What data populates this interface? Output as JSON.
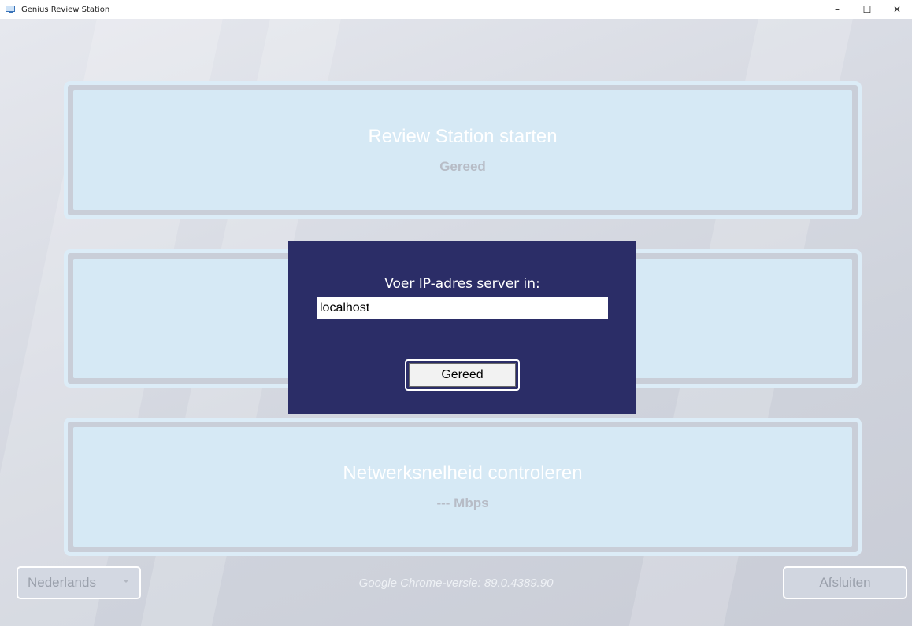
{
  "window": {
    "title": "Genius Review Station",
    "controls": {
      "minimize": "–",
      "maximize": "☐",
      "close": "✕"
    }
  },
  "panels": [
    {
      "title": "Review Station starten",
      "status": "Gereed"
    },
    {
      "title": "",
      "status": ""
    },
    {
      "title": "Netwerksnelheid controleren",
      "status": "--- Mbps"
    }
  ],
  "footer": {
    "language_selected": "Nederlands",
    "version_text": "Google Chrome-versie:  89.0.4389.90",
    "exit_label": "Afsluiten"
  },
  "dialog": {
    "label": "Voer IP-adres server in:",
    "ip_value": "localhost",
    "ok_label": "Gereed"
  },
  "colors": {
    "dialog_bg": "#2b2d67",
    "panel_fill": "#d6e9f5",
    "panel_border": "#dcecf7"
  }
}
